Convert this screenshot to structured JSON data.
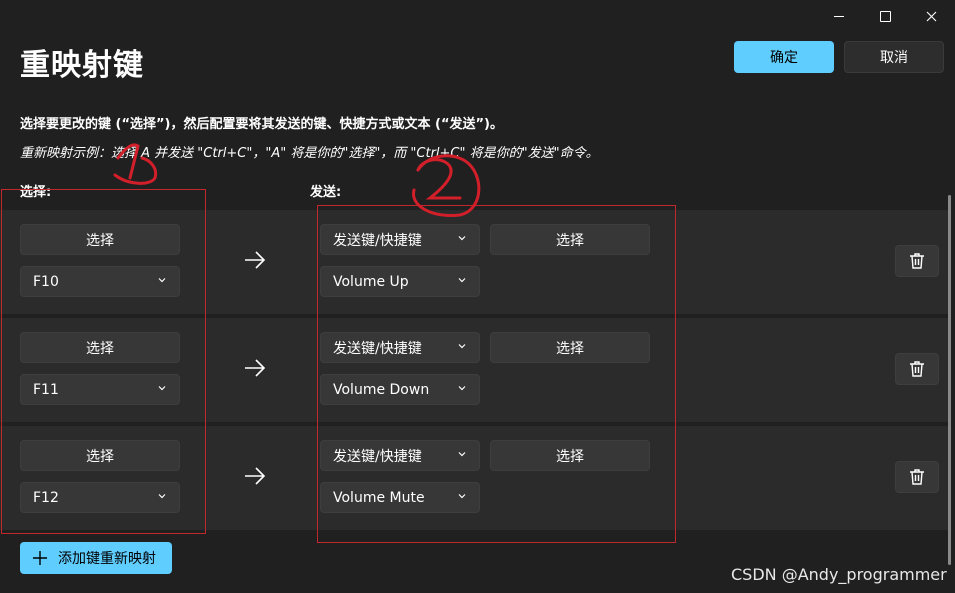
{
  "window": {
    "title": "重映射键",
    "ok_label": "确定",
    "cancel_label": "取消"
  },
  "description": "选择要更改的键 (“选择”)，然后配置要将其发送的键、快捷方式或文本 (“发送”)。",
  "example": "重新映射示例：选择 A 并发送 \"Ctrl+C\"，\"A\" 将是你的\"选择\"，而 \"Ctrl+C\" 将是你的\"发送\"命令。",
  "columns": {
    "select": "选择:",
    "send": "发送:"
  },
  "rows": [
    {
      "select_button": "选择",
      "key": "F10",
      "send_type": "发送键/快捷键",
      "send_select_button": "选择",
      "send_value": "Volume Up"
    },
    {
      "select_button": "选择",
      "key": "F11",
      "send_type": "发送键/快捷键",
      "send_select_button": "选择",
      "send_value": "Volume Down"
    },
    {
      "select_button": "选择",
      "key": "F12",
      "send_type": "发送键/快捷键",
      "send_select_button": "选择",
      "send_value": "Volume Mute"
    }
  ],
  "add_button": "添加键重新映射",
  "icons": {
    "minimize": "minimize-icon",
    "maximize": "maximize-icon",
    "close": "close-icon",
    "arrow": "arrow-right-icon",
    "trash": "trash-icon",
    "plus": "plus-icon",
    "chevron": "chevron-down-icon"
  },
  "colors": {
    "accent": "#60cdff",
    "background": "#202020",
    "row": "#2b2b2b",
    "annotation": "#c0282d"
  },
  "annotations": {
    "mark_1": "1",
    "mark_2": "2"
  },
  "watermark": "CSDN @Andy_programmer"
}
